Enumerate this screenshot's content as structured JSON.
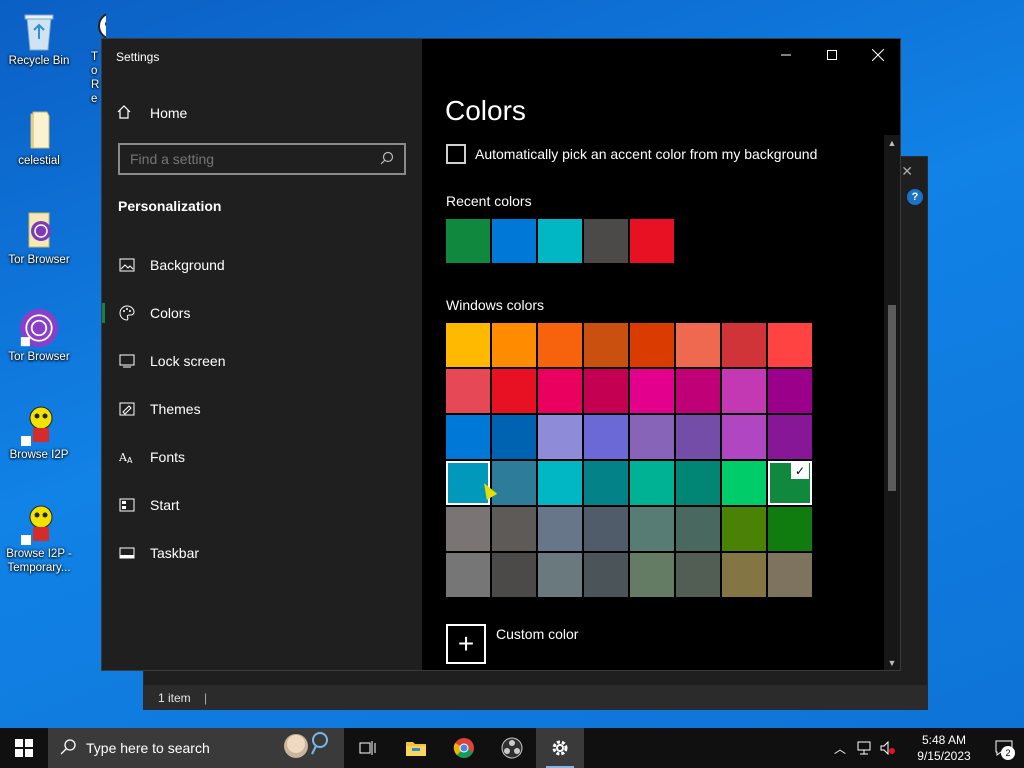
{
  "desktop": {
    "icons": [
      {
        "label": "Recycle Bin"
      },
      {
        "label": "celestial"
      },
      {
        "label": "Tor Browser"
      },
      {
        "label": "Tor Browser"
      },
      {
        "label": "Browse I2P"
      },
      {
        "label": "Browse I2P - Temporary..."
      }
    ],
    "partial_icon_text": "To Re"
  },
  "explorer": {
    "status_text": "1 item",
    "help_label": "?"
  },
  "settings": {
    "window_title": "Settings",
    "home_label": "Home",
    "search_placeholder": "Find a setting",
    "section_label": "Personalization",
    "nav": [
      {
        "label": "Background",
        "icon": "image-icon"
      },
      {
        "label": "Colors",
        "icon": "palette-icon"
      },
      {
        "label": "Lock screen",
        "icon": "lock-screen-icon"
      },
      {
        "label": "Themes",
        "icon": "themes-icon"
      },
      {
        "label": "Fonts",
        "icon": "fonts-icon"
      },
      {
        "label": "Start",
        "icon": "start-icon"
      },
      {
        "label": "Taskbar",
        "icon": "taskbar-icon"
      }
    ],
    "page_title": "Colors",
    "auto_pick_label": "Automatically pick an accent color from my background",
    "recent_label": "Recent colors",
    "recent_colors": [
      "#10893e",
      "#0078d7",
      "#00b7c3",
      "#4c4a48",
      "#e81123"
    ],
    "windows_label": "Windows colors",
    "windows_colors": [
      "#ffb900",
      "#ff8c00",
      "#f7630c",
      "#ca5010",
      "#da3b01",
      "#ef6950",
      "#d13438",
      "#ff4343",
      "#e74856",
      "#e81123",
      "#ea005e",
      "#c30052",
      "#e3008c",
      "#bf0077",
      "#c239b3",
      "#9a0089",
      "#0078d7",
      "#0063b1",
      "#8e8cd8",
      "#6b69d6",
      "#8764b8",
      "#744da9",
      "#b146c2",
      "#881798",
      "#0099bc",
      "#2d7d9a",
      "#00b7c3",
      "#038387",
      "#00b294",
      "#018574",
      "#00cc6a",
      "#10893e",
      "#7a7574",
      "#5d5a58",
      "#68768a",
      "#515c6b",
      "#567c73",
      "#486860",
      "#498205",
      "#107c10",
      "#767676",
      "#4c4a48",
      "#69797e",
      "#4a5459",
      "#647c64",
      "#525e54",
      "#847545",
      "#7e735f"
    ],
    "selected_color_index": 31,
    "hover_color_index": 24,
    "custom_label": "Custom color",
    "check_glyph": "✓"
  },
  "taskbar": {
    "search_placeholder": "Type here to search",
    "time": "5:48 AM",
    "date": "9/15/2023",
    "notification_count": "2"
  }
}
